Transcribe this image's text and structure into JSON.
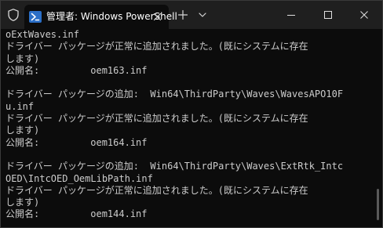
{
  "window": {
    "tab_title": "管理者: Windows PowerShell"
  },
  "icons": {
    "admin": "shield-icon",
    "tab": "powershell-icon",
    "close_tab": "close-icon",
    "new_tab": "plus-icon",
    "dropdown": "chevron-down-icon",
    "minimize": "minimize-icon",
    "maximize": "maximize-icon",
    "close_window": "close-icon"
  },
  "colors": {
    "titlebar_bg": "#1f1f1f",
    "console_bg": "#0c0c0c",
    "console_text": "#cccccc",
    "ps_icon": "#2b6fc7"
  },
  "console": {
    "lines": [
      "oExtWaves.inf",
      "ドライバー パッケージが正常に追加されました。(既にシステムに存在",
      "します)",
      "公開名:         oem163.inf",
      "",
      "ドライバー パッケージの追加:  Win64\\ThirdParty\\Waves\\WavesAPO10F",
      "u.inf",
      "ドライバー パッケージが正常に追加されました。(既にシステムに存在",
      "します)",
      "公開名:         oem164.inf",
      "",
      "ドライバー パッケージの追加:  Win64\\ThirdParty\\Waves\\ExtRtk_Intc",
      "OED\\IntcOED_OemLibPath.inf",
      "ドライバー パッケージが正常に追加されました。(既にシステムに存在",
      "します)",
      "公開名:         oem144.inf"
    ]
  }
}
